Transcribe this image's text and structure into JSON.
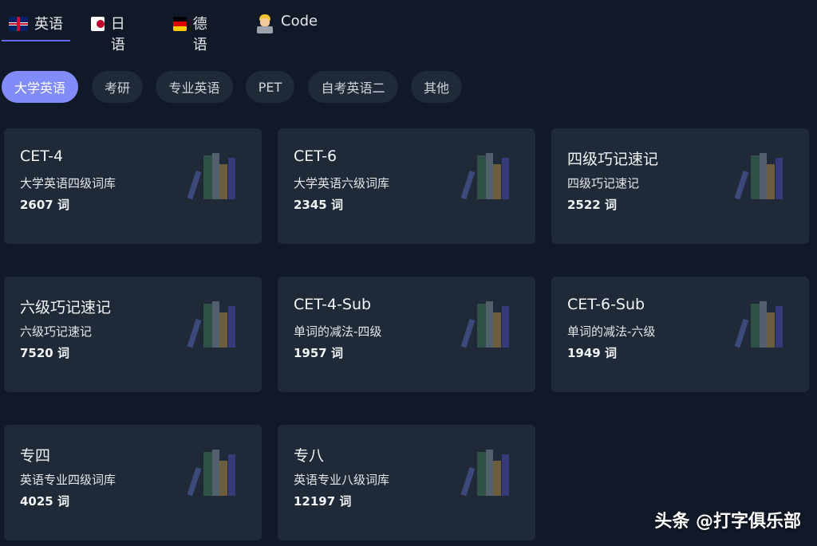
{
  "lang_tabs": [
    {
      "label": "英语",
      "icon": "uk-flag-icon"
    },
    {
      "label": "日语",
      "icon": "japan-flag-icon"
    },
    {
      "label": "德语",
      "icon": "germany-flag-icon"
    },
    {
      "label": "Code",
      "icon": "coder-icon"
    }
  ],
  "categories": [
    "大学英语",
    "考研",
    "专业英语",
    "PET",
    "自考英语二",
    "其他"
  ],
  "cards": [
    {
      "title": "CET-4",
      "subtitle": "大学英语四级词库",
      "count": "2607 词"
    },
    {
      "title": "CET-6",
      "subtitle": "大学英语六级词库",
      "count": "2345 词"
    },
    {
      "title": "四级巧记速记",
      "subtitle": "四级巧记速记",
      "count": "2522 词"
    },
    {
      "title": "六级巧记速记",
      "subtitle": "六级巧记速记",
      "count": "7520 词"
    },
    {
      "title": "CET-4-Sub",
      "subtitle": "单词的减法-四级",
      "count": "1957 词"
    },
    {
      "title": "CET-6-Sub",
      "subtitle": "单词的减法-六级",
      "count": "1949 词"
    },
    {
      "title": "专四",
      "subtitle": "英语专业四级词库",
      "count": "4025 词"
    },
    {
      "title": "专八",
      "subtitle": "英语专业八级词库",
      "count": "12197 词"
    }
  ],
  "watermark": "头条 @打字俱乐部",
  "colors": {
    "background": "#111827",
    "card": "#1f2937",
    "accent": "#818cf8",
    "tab_underline": "#6366f1"
  }
}
